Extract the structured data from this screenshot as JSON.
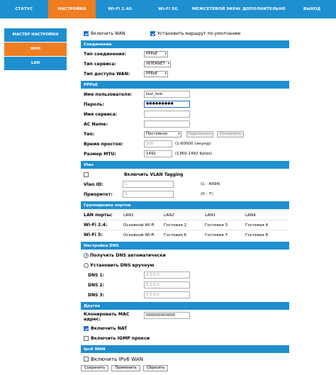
{
  "topnav": {
    "tabs": [
      "СТАТУС",
      "НАСТРОЙКА",
      "WI-FI 2.4G",
      "WI-FI 5G",
      "МЕЖСЕТЕВОЙ ЭКРАН",
      "ДОПОЛНИТЕЛЬНО",
      "ВЫХОД"
    ],
    "active_index": 1
  },
  "leftmenu": {
    "items": [
      "МАСТЕР НАСТРОЙКИ",
      "WAN",
      "LAN"
    ],
    "active_index": 1
  },
  "wan_top": {
    "enable_wan_label": "Включить WAN",
    "enable_wan_checked": true,
    "default_route_label": "Установить маршрут по-умолчанию",
    "default_route_checked": true
  },
  "connection": {
    "title": "Соединение",
    "conn_type_label": "Тип соединения:",
    "conn_type_value": "PPPoE",
    "service_type_label": "Тип сервиса:",
    "service_type_value": "INTERNET",
    "wan_access_label": "Тип доступа WAN:",
    "wan_access_value": "PPPoE"
  },
  "pppoe": {
    "title": "PPPoE",
    "username_label": "Имя пользователя:",
    "username_value": "test_test",
    "password_label": "Пароль:",
    "password_value": "●●●●●●●●●",
    "service_name_label": "Имя сервиса:",
    "service_name_value": "",
    "ac_name_label": "AC Name:",
    "ac_name_value": "",
    "type_label": "Тип:",
    "type_value": "Постоянно",
    "connect_button": "Подключить",
    "disconnect_button": "Отключить",
    "idle_label": "Время простоя:",
    "idle_value": "300",
    "idle_hint": "(1-60000 секунд)",
    "mtu_label": "Размер MTU:",
    "mtu_value": "1492",
    "mtu_hint": "(1360-1492 bytes)"
  },
  "vlan": {
    "title": "Vlan",
    "tagging_label": "Включить VLAN Tagging",
    "tagging_checked": false,
    "vlan_id_label": "Vlan ID:",
    "vlan_id_value": "1",
    "vlan_id_hint": "(1 - 4094)",
    "priority_label": "Приоритет:",
    "priority_value": "0",
    "priority_hint": "(0 - 7)"
  },
  "ports": {
    "title": "Группировка портов",
    "rows": [
      {
        "label": "LAN порты:",
        "cells": [
          "LAN1",
          "LAN2",
          "LAN3",
          "LAN4"
        ]
      },
      {
        "label": "Wi-Fi 2.4:",
        "cells": [
          "Основной Wi-Fi",
          "Гостевая 2",
          "Гостевая 3",
          "Гостевая 4"
        ]
      },
      {
        "label": "Wi-Fi 5:",
        "cells": [
          "Основной Wi-Fi",
          "Гостевая 6",
          "Гостевая 7",
          "Гостевая 8"
        ]
      }
    ]
  },
  "dns": {
    "title": "Настройка DNS",
    "auto_label": "Получить DNS автоматически",
    "manual_label": "Установить DNS вручную",
    "auto_selected": true,
    "dns1_label": "DNS 1:",
    "dns1_value": "0.0.0.0",
    "dns2_label": "DNS 2:",
    "dns2_value": "0.0.0.0",
    "dns3_label": "DNS 3:",
    "dns3_value": "0.0.0.0"
  },
  "other": {
    "title": "Другое",
    "clone_mac_label_1": "Клонировать MAC",
    "clone_mac_label_2": "адрес:",
    "clone_mac_value": "000000000000",
    "nat_label": "Включить NAT",
    "nat_checked": true,
    "igmp_label": "Включить IGMP прокси",
    "igmp_checked": false
  },
  "ipv6": {
    "title": "Ipv6 WAN",
    "enable_label": "Включить IPv6 WAN",
    "enable_checked": false
  },
  "actions": {
    "save": "Сохранить",
    "apply": "Применить",
    "reset": "Сбросить"
  },
  "colors": {
    "nav_blue": "#1e8fcf",
    "active_orange": "#ef7d22",
    "check_blue": "#1e6fd9"
  }
}
